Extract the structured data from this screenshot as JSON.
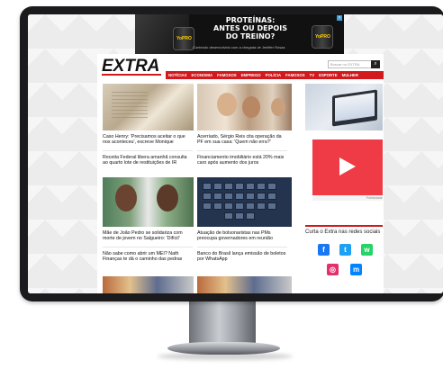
{
  "ad": {
    "headline_1": "PROTEÍNAS:",
    "headline_2": "ANTES OU DEPOIS",
    "headline_3": "DO TREINO?",
    "product_left": "YoPRO",
    "product_right": "YoPRO",
    "footnote": "Conteúdo desenvolvido com a chegada de Jeniffer Rosas",
    "close_label": "×",
    "info_label": "AD"
  },
  "site": {
    "logo_text": "EXTRA",
    "search_placeholder": "Buscar no EXTRA",
    "search_button_icon": "search-icon"
  },
  "nav": {
    "items": [
      "NOTÍCIAS",
      "ECONOMIA",
      "FAMOSOS",
      "EMPREGO",
      "POLÍCIA",
      "FAMOSOS",
      "TV",
      "ESPORTE",
      "MULHER"
    ]
  },
  "articles": [
    {
      "caption": "Caso Henry: 'Precisamos aceitar o que nos aconteceu', escreve Monique"
    },
    {
      "caption": "Acerriado, Sérgio Reis cita operação da PF em sua casa: 'Quem não erra?'"
    },
    {
      "caption": "Receita Federal libera amanhã consulta ao quarto lote de restituições de IR"
    },
    {
      "caption": "Financiamento imobiliário está 20% mais caro após aumento dos juros"
    },
    {
      "caption": "Mãe de João Pedro se solidariza com morte de jovem no Salgueiro: 'Difícil'"
    },
    {
      "caption": "Atuação de bolsonaristas nas PMs preocupa governadores em reunião"
    },
    {
      "caption": "Não sabe como abrir um MEI? Nath Finanças te dá o caminho das pedras"
    },
    {
      "caption": "Banco do Brasil lança emissão de boletos por WhatsApp"
    }
  ],
  "sidebar": {
    "video_credit": "Publicidade",
    "share_title": "Curta o Extra nas redes sociais",
    "social": [
      {
        "icon": "facebook-icon",
        "glyph": "f",
        "color": "#1877f2"
      },
      {
        "icon": "twitter-icon",
        "glyph": "t",
        "color": "#1da1f2"
      },
      {
        "icon": "whatsapp-icon",
        "glyph": "w",
        "color": "#25d366"
      },
      {
        "icon": "instagram-icon",
        "glyph": "◎",
        "color": "#e1306c"
      },
      {
        "icon": "messenger-icon",
        "glyph": "m",
        "color": "#0084ff"
      }
    ]
  },
  "colors": {
    "brand_red": "#d2191e",
    "video_red": "#ef3b45"
  }
}
